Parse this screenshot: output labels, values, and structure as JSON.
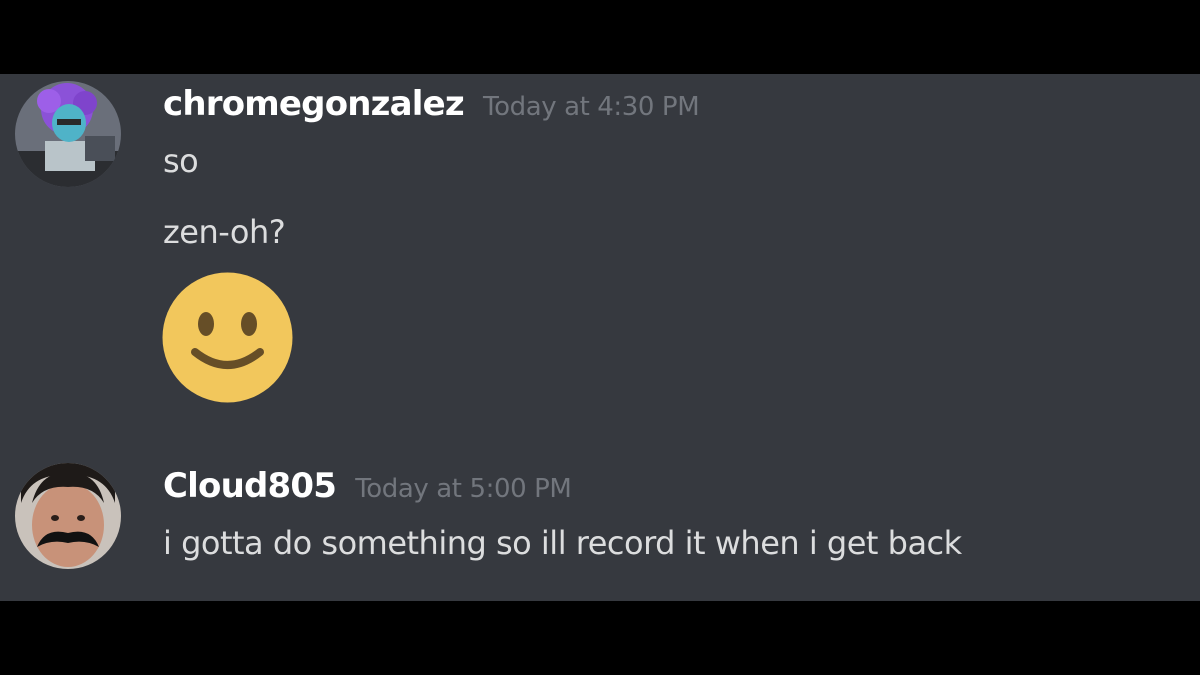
{
  "messages": [
    {
      "author": "chromegonzalez",
      "timestamp": "Today at 4:30 PM",
      "lines": [
        "so",
        "zen-oh?"
      ],
      "emoji": "slightly-smiling-face-emoji",
      "avatar": "purple-haired-avatar"
    },
    {
      "author": "Cloud805",
      "timestamp": "Today at 5:00 PM",
      "lines": [
        "i gotta do something so ill record it when i get back"
      ],
      "avatar": "mustache-man-avatar"
    }
  ],
  "colors": {
    "background": "#36393f",
    "username": "#ffffff",
    "timestamp": "#72767d",
    "message_text": "#dcddde",
    "emoji_face": "#f2c75c"
  }
}
